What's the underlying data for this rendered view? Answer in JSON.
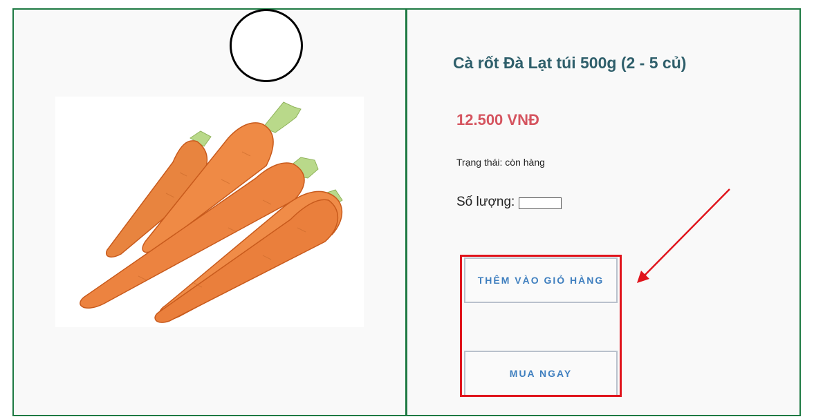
{
  "product": {
    "title": "Cà rốt Đà Lạt túi 500g (2 - 5 củ)",
    "price": "12.500 VNĐ",
    "status": "Trạng thái: còn hàng",
    "quantity_label": "Số lượng:",
    "quantity_value": ""
  },
  "actions": {
    "add_to_cart": "THÊM VÀO GIỎ HÀNG",
    "buy_now": "MUA NGAY"
  },
  "colors": {
    "panel_border": "#1e7a43",
    "title": "#2f5f6b",
    "price": "#d5545f",
    "button_text": "#3f7fbf",
    "annotation": "#e0141c"
  },
  "icons": {
    "image": "carrot-product-image",
    "annotation_arrow": "arrow-icon"
  }
}
